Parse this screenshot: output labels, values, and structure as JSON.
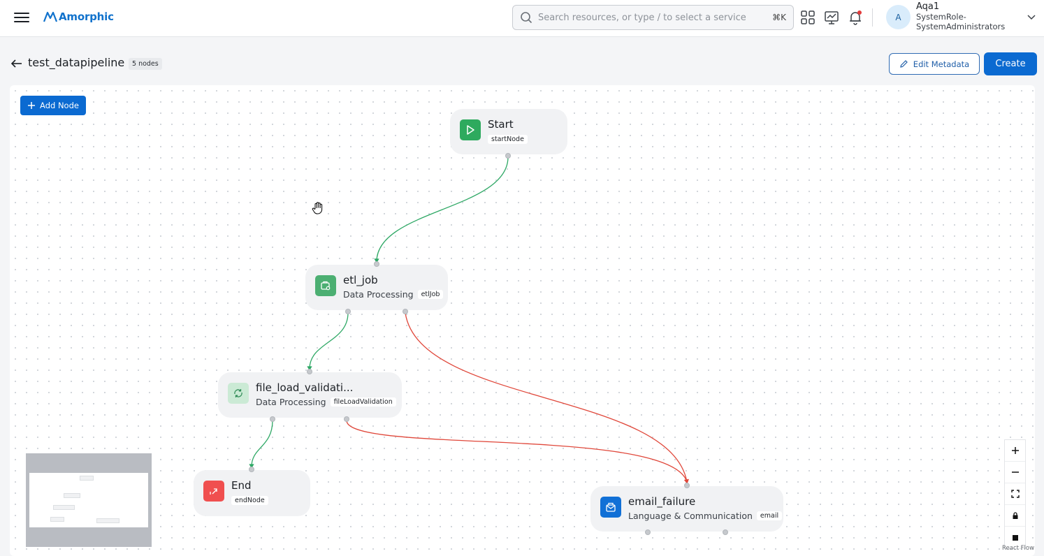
{
  "app": {
    "brand": "Amorphic",
    "search_placeholder": "Search resources, or type / to select a service",
    "search_shortcut": "⌘K",
    "icons": [
      "menu-icon",
      "apps-grid-icon",
      "monitor-chart-icon",
      "bell-icon"
    ],
    "accent_color": "#0b6ad1"
  },
  "user": {
    "initial": "A",
    "name": "Aqa1",
    "role_line1": "SystemRole-",
    "role_line2": "SystemAdministrators"
  },
  "page": {
    "title": "test_datapipeline",
    "node_count": "5 nodes",
    "edit_metadata_label": "Edit Metadata",
    "create_label": "Create",
    "add_node_label": "Add Node"
  },
  "nodes": {
    "start": {
      "title": "Start",
      "tag": "startNode",
      "icon": "play-icon",
      "color": "#2eaa5e"
    },
    "etl_job": {
      "title": "etl_job",
      "category": "Data Processing",
      "tag": "etlJob",
      "icon": "gear-folder-icon",
      "color": "#4caf72"
    },
    "file_load": {
      "title": "file_load_validati...",
      "category": "Data Processing",
      "tag": "fileLoadValidation",
      "icon": "refresh-icon",
      "color": "#cbead5"
    },
    "end": {
      "title": "End",
      "tag": "endNode",
      "icon": "exit-icon",
      "color": "#f04f4f"
    },
    "email_failure": {
      "title": "email_failure",
      "category": "Language & Communication",
      "tag": "email",
      "icon": "mail-icon",
      "color": "#1170d6"
    }
  },
  "edge_colors": {
    "success": "#2ea865",
    "failure": "#e0473a"
  },
  "flow": {
    "attribution": "React Flow"
  }
}
